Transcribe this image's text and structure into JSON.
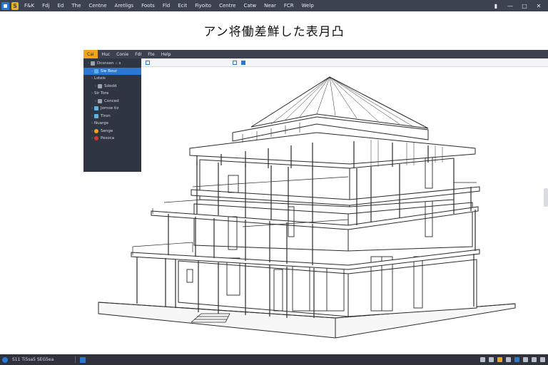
{
  "menubar": {
    "badge": "S",
    "items": [
      "F&K",
      "Fdj",
      "Ed",
      "The",
      "Centne",
      "Aretligs",
      "Foots",
      "Fld",
      "Ecit",
      "Fiyoito",
      "Centre",
      "Catw",
      "Near",
      "FCR",
      "Welp"
    ]
  },
  "heading": "アン将働差鮮した表月凸",
  "inner": {
    "file_label": "Cai",
    "menu": [
      "Huc",
      "Conie",
      "FdI",
      "Fte",
      "Help"
    ]
  },
  "tree": [
    {
      "label": "Dcsnsen :: s",
      "icon": "sheet",
      "depth": 0
    },
    {
      "label": "Sie Bour",
      "icon": "cube",
      "depth": 1,
      "selected": true
    },
    {
      "label": "Lsteis",
      "icon": "none",
      "depth": 1
    },
    {
      "label": "Sdodd",
      "icon": "sheet",
      "depth": 2
    },
    {
      "label": "Sir Tore",
      "icon": "none",
      "depth": 1
    },
    {
      "label": "Conced",
      "icon": "sheet",
      "depth": 2
    },
    {
      "label": "Jomoe tiz",
      "icon": "cube",
      "depth": 1
    },
    {
      "label": "Tiron",
      "icon": "cube",
      "depth": 1
    },
    {
      "label": "Nuarge",
      "icon": "none",
      "depth": 1
    },
    {
      "label": "Senge",
      "icon": "warn",
      "depth": 1
    },
    {
      "label": "Pesoca",
      "icon": "err",
      "depth": 1
    }
  ],
  "taskbar": {
    "text": "S11 Ti5sa5 SEG5ea"
  },
  "colors": {
    "menubar": "#3c4250",
    "accent": "#2b78d4",
    "file_tab": "#f0a51d",
    "panel": "#2f3541"
  }
}
